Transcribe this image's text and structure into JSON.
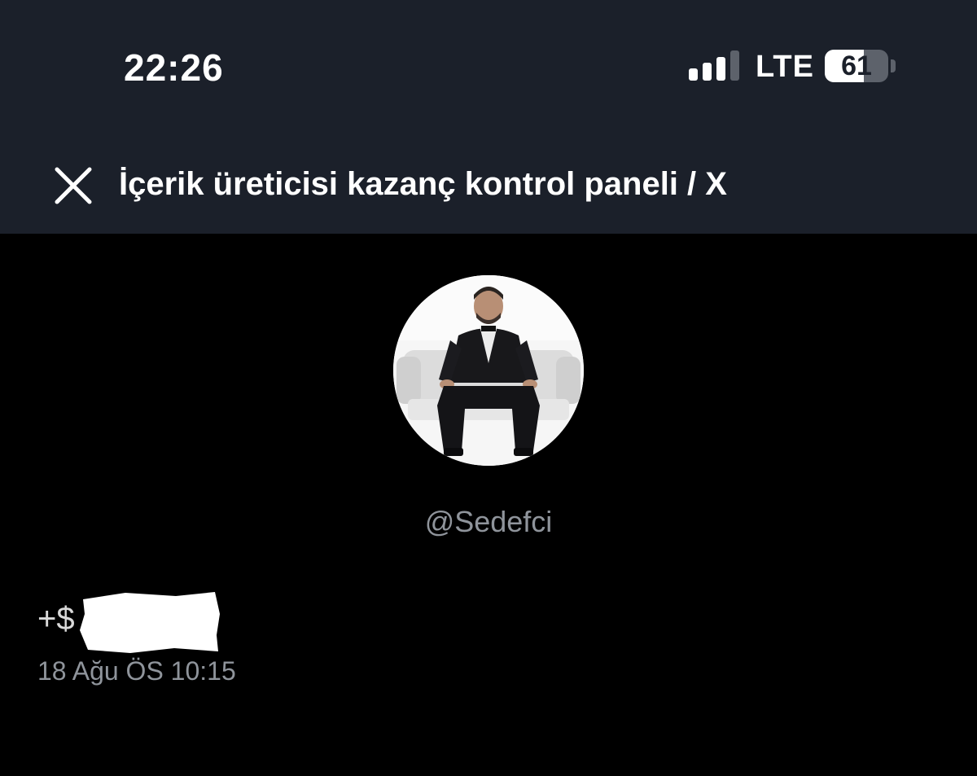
{
  "status_bar": {
    "time": "22:26",
    "network": "LTE",
    "battery_percent": 61,
    "battery_label": "61",
    "signal_bars_active": 3,
    "signal_bars_total": 4
  },
  "header": {
    "close_icon": "close-icon",
    "title": "İçerik üreticisi kazanç kontrol paneli / X"
  },
  "profile": {
    "handle": "@Sedefci"
  },
  "earnings": {
    "amount_prefix": "+$",
    "date": "18 Ağu ÖS 10:15"
  },
  "colors": {
    "topbar_bg": "#1b202a",
    "page_bg": "#000000",
    "secondary_text": "#8f949b"
  }
}
